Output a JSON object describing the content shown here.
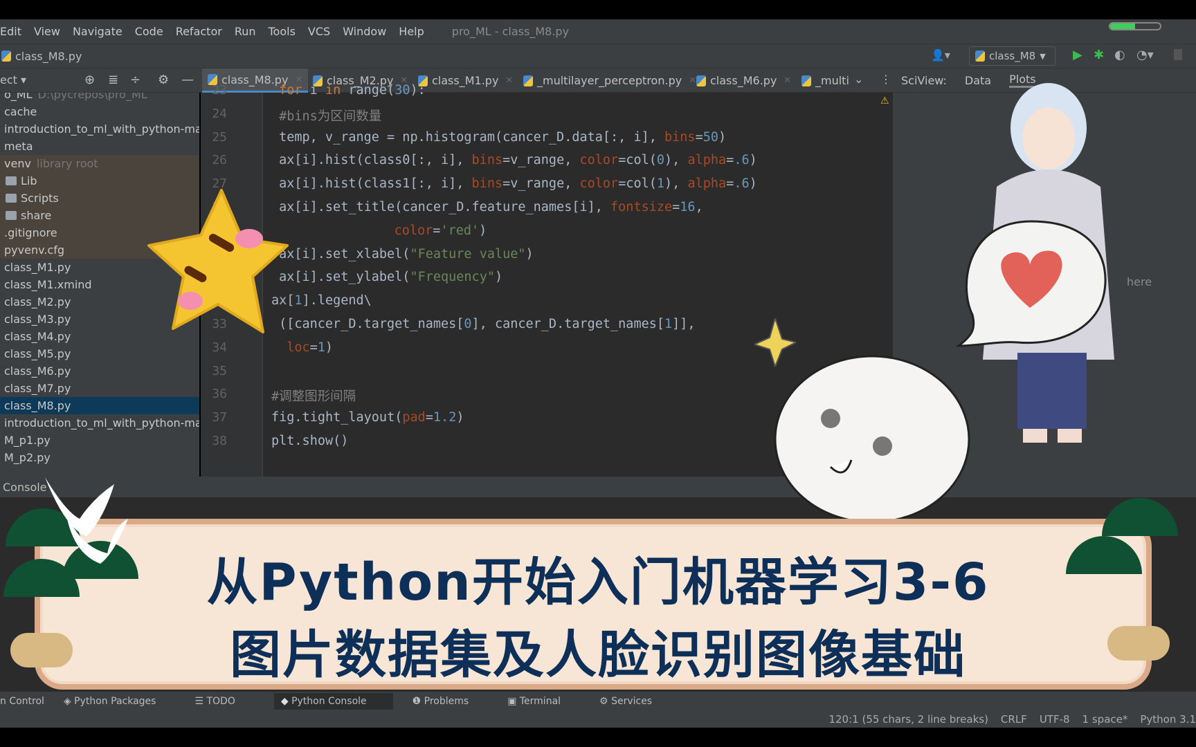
{
  "menu": {
    "items": [
      "Edit",
      "View",
      "Navigate",
      "Code",
      "Refactor",
      "Run",
      "Tools",
      "VCS",
      "Window",
      "Help"
    ],
    "window_title": "pro_ML - class_M8.py"
  },
  "nav": {
    "breadcrumb": "class_M8.py",
    "run_config": "class_M8"
  },
  "project": {
    "label": "ect"
  },
  "tabs": [
    "class_M8.py",
    "class_M2.py",
    "class_M1.py",
    "_multilayer_perceptron.py",
    "class_M6.py",
    "_multi"
  ],
  "sciview": {
    "label": "SciView:",
    "data": "Data",
    "plots": "Plots",
    "message": "here"
  },
  "sidebar": {
    "items": [
      {
        "label": "o_ML",
        "extra": "D:\\pycrepos\\pro_ML"
      },
      {
        "label": "cache"
      },
      {
        "label": "introduction_to_ml_with_python-maste"
      },
      {
        "label": "meta"
      },
      {
        "label": "venv",
        "extra": "library root"
      },
      {
        "label": "Lib"
      },
      {
        "label": "Scripts"
      },
      {
        "label": "share"
      },
      {
        "label": ".gitignore"
      },
      {
        "label": "pyvenv.cfg"
      },
      {
        "label": "class_M1.py"
      },
      {
        "label": "class_M1.xmind"
      },
      {
        "label": "class_M2.py"
      },
      {
        "label": "class_M3.py"
      },
      {
        "label": "class_M4.py"
      },
      {
        "label": "class_M5.py"
      },
      {
        "label": "class_M6.py"
      },
      {
        "label": "class_M7.py"
      },
      {
        "label": "class_M8.py"
      },
      {
        "label": "introduction_to_ml_with_python-maste"
      },
      {
        "label": "M_p1.py"
      },
      {
        "label": "M_p2.py"
      }
    ]
  },
  "code": [
    {
      "n": "23",
      "indent": 1,
      "tokens": [
        [
          "for ",
          "kw"
        ],
        [
          "i ",
          ""
        ],
        [
          "in ",
          "kw"
        ],
        [
          "range(",
          ""
        ],
        [
          "30",
          "num"
        ],
        [
          "):",
          ""
        ]
      ]
    },
    {
      "n": "24",
      "indent": 1,
      "tokens": [
        [
          "#bins为区间数量",
          "cm"
        ]
      ]
    },
    {
      "n": "25",
      "indent": 1,
      "tokens": [
        [
          "temp, v_range = np.histogram(cancer_D.data[:, i], ",
          ""
        ],
        [
          "bins",
          "arg"
        ],
        [
          "=",
          ""
        ],
        [
          "50",
          "num"
        ],
        [
          ")",
          ""
        ]
      ]
    },
    {
      "n": "26",
      "indent": 1,
      "tokens": [
        [
          "ax[i].hist(class0[:, i], ",
          ""
        ],
        [
          "bins",
          "arg"
        ],
        [
          "=v_range, ",
          ""
        ],
        [
          "color",
          "arg"
        ],
        [
          "=col(",
          ""
        ],
        [
          "0",
          "num"
        ],
        [
          "), ",
          ""
        ],
        [
          "alpha",
          "arg"
        ],
        [
          "=",
          ""
        ],
        [
          ".6",
          "num"
        ],
        [
          ")",
          ""
        ]
      ]
    },
    {
      "n": "27",
      "indent": 1,
      "tokens": [
        [
          "ax[i].hist(class1[:, i], ",
          ""
        ],
        [
          "bins",
          "arg"
        ],
        [
          "=v_range, ",
          ""
        ],
        [
          "color",
          "arg"
        ],
        [
          "=col(",
          ""
        ],
        [
          "1",
          "num"
        ],
        [
          "), ",
          ""
        ],
        [
          "alpha",
          "arg"
        ],
        [
          "=",
          ""
        ],
        [
          ".6",
          "num"
        ],
        [
          ")",
          ""
        ]
      ]
    },
    {
      "n": "28",
      "indent": 1,
      "tokens": [
        [
          "ax[i].set_title(cancer_D.feature_names[i], ",
          ""
        ],
        [
          "fontsize",
          "arg"
        ],
        [
          "=",
          ""
        ],
        [
          "16",
          "num"
        ],
        [
          ",",
          ""
        ]
      ]
    },
    {
      "n": "29",
      "indent": 16,
      "tokens": [
        [
          "color",
          "arg"
        ],
        [
          "=",
          ""
        ],
        [
          "'red'",
          "str"
        ],
        [
          ")",
          ""
        ]
      ]
    },
    {
      "n": "30",
      "indent": 1,
      "tokens": [
        [
          "ax[i].set_xlabel(",
          ""
        ],
        [
          "\"Feature value\"",
          "str"
        ],
        [
          ")",
          ""
        ]
      ]
    },
    {
      "n": "31",
      "indent": 1,
      "tokens": [
        [
          "ax[i].set_ylabel(",
          ""
        ],
        [
          "\"Frequency\"",
          "str"
        ],
        [
          ")",
          ""
        ]
      ]
    },
    {
      "n": "32",
      "indent": 0,
      "tokens": [
        [
          "ax[",
          ""
        ],
        [
          "1",
          "num"
        ],
        [
          "].legend\\",
          ""
        ]
      ]
    },
    {
      "n": "33",
      "indent": 1,
      "tokens": [
        [
          "([cancer_D.target_names[",
          ""
        ],
        [
          "0",
          "num"
        ],
        [
          "], cancer_D.target_names[",
          ""
        ],
        [
          "1",
          "num"
        ],
        [
          "]],",
          ""
        ]
      ]
    },
    {
      "n": "34",
      "indent": 2,
      "tokens": [
        [
          "loc",
          "arg"
        ],
        [
          "=",
          ""
        ],
        [
          "1",
          "num"
        ],
        [
          ")",
          ""
        ]
      ]
    },
    {
      "n": "35",
      "indent": 0,
      "tokens": []
    },
    {
      "n": "36",
      "indent": 0,
      "tokens": [
        [
          "#调整图形间隔",
          "cm"
        ]
      ]
    },
    {
      "n": "37",
      "indent": 0,
      "tokens": [
        [
          "fig.tight_layout(",
          ""
        ],
        [
          "pad",
          "arg"
        ],
        [
          "=",
          ""
        ],
        [
          "1.2",
          "num"
        ],
        [
          ")",
          ""
        ]
      ]
    },
    {
      "n": "38",
      "indent": 0,
      "tokens": [
        [
          "plt.show()",
          ""
        ]
      ]
    }
  ],
  "console": {
    "label": "Console"
  },
  "toolwindows": [
    "n Control",
    "Python Packages",
    "TODO",
    "Python Console",
    "Problems",
    "Terminal",
    "Services"
  ],
  "status": {
    "position": "120:1 (55 chars, 2 line breaks)",
    "line_sep": "CRLF",
    "encoding": "UTF-8",
    "indent": "1 space*",
    "interpreter": "Python 3.1"
  },
  "banner": {
    "line1": "从Python开始入门机器学习3-6",
    "line2": "图片数据集及人脸识别图像基础"
  },
  "colors": {
    "ide_bg": "#2b2b2b",
    "panel": "#3c3f41",
    "banner_bg": "#f7e6d6",
    "banner_text": "#0e2f57",
    "pine": "#0f5132"
  }
}
